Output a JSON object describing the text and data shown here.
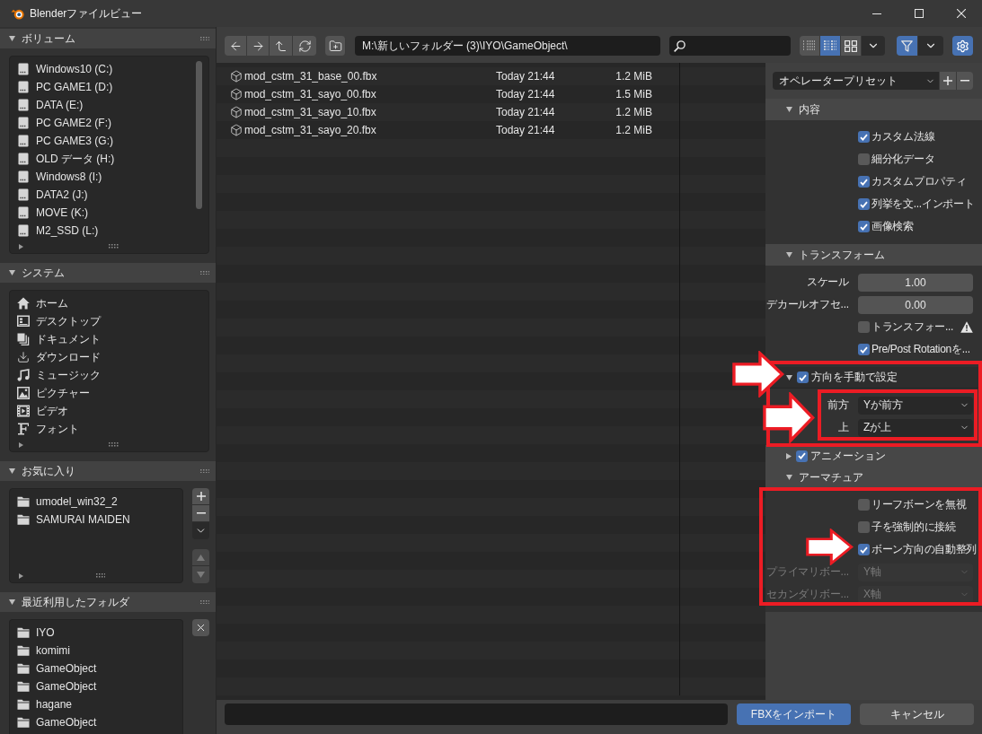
{
  "window": {
    "title": "Blenderファイルビュー"
  },
  "sidebar": {
    "panels": [
      {
        "title": "ボリューム",
        "expanded": true,
        "scrollbar": true,
        "items": [
          {
            "label": "Windows10 (C:)",
            "kind": "drive"
          },
          {
            "label": "PC GAME1 (D:)",
            "kind": "drive"
          },
          {
            "label": "DATA (E:)",
            "kind": "drive"
          },
          {
            "label": "PC GAME2 (F:)",
            "kind": "drive"
          },
          {
            "label": "PC GAME3 (G:)",
            "kind": "drive"
          },
          {
            "label": "OLD データ (H:)",
            "kind": "drive"
          },
          {
            "label": "Windows8 (I:)",
            "kind": "drive"
          },
          {
            "label": "DATA2 (J:)",
            "kind": "drive"
          },
          {
            "label": "MOVE (K:)",
            "kind": "drive"
          },
          {
            "label": "M2_SSD (L:)",
            "kind": "drive"
          }
        ]
      },
      {
        "title": "システム",
        "expanded": true,
        "scrollbar": false,
        "items": [
          {
            "label": "ホーム",
            "kind": "home"
          },
          {
            "label": "デスクトップ",
            "kind": "desktop"
          },
          {
            "label": "ドキュメント",
            "kind": "documents"
          },
          {
            "label": "ダウンロード",
            "kind": "downloads"
          },
          {
            "label": "ミュージック",
            "kind": "music"
          },
          {
            "label": "ピクチャー",
            "kind": "pictures"
          },
          {
            "label": "ビデオ",
            "kind": "videos"
          },
          {
            "label": "フォント",
            "kind": "fonts"
          }
        ]
      },
      {
        "title": "お気に入り",
        "expanded": true,
        "scrollbar": false,
        "items": [
          {
            "label": "umodel_win32_2",
            "kind": "folder"
          },
          {
            "label": "SAMURAI MAIDEN",
            "kind": "folder"
          }
        ],
        "buttons": [
          {
            "kind": "add",
            "disabled": false
          },
          {
            "kind": "remove",
            "disabled": false
          },
          {
            "kind": "menu",
            "disabled": false
          },
          {
            "kind": "up",
            "disabled": true
          },
          {
            "kind": "down",
            "disabled": true
          }
        ]
      },
      {
        "title": "最近利用したフォルダ",
        "expanded": true,
        "scrollbar": false,
        "items": [
          {
            "label": "IYO",
            "kind": "folder"
          },
          {
            "label": "komimi",
            "kind": "folder"
          },
          {
            "label": "GameObject",
            "kind": "folder"
          },
          {
            "label": "GameObject",
            "kind": "folder"
          },
          {
            "label": "hagane",
            "kind": "folder"
          },
          {
            "label": "GameObject",
            "kind": "folder"
          }
        ],
        "buttons": [
          {
            "kind": "clear",
            "disabled": false
          }
        ]
      }
    ]
  },
  "toolbar": {
    "path": "M:\\新しいフォルダー (3)\\IYO\\GameObject\\",
    "view_modes": [
      {
        "kind": "vertical_list",
        "selected": false
      },
      {
        "kind": "horizontal_list",
        "selected": true
      },
      {
        "kind": "thumbnails",
        "selected": false
      }
    ],
    "filter": {
      "on": true
    },
    "settings": {
      "on": true
    }
  },
  "files": [
    {
      "name": "mod_cstm_31_base_00.fbx",
      "date": "Today 21:44",
      "size": "1.2 MiB"
    },
    {
      "name": "mod_cstm_31_sayo_00.fbx",
      "date": "Today 21:44",
      "size": "1.5 MiB"
    },
    {
      "name": "mod_cstm_31_sayo_10.fbx",
      "date": "Today 21:44",
      "size": "1.2 MiB"
    },
    {
      "name": "mod_cstm_31_sayo_20.fbx",
      "date": "Today 21:44",
      "size": "1.2 MiB"
    }
  ],
  "operator": {
    "preset": "オペレータープリセット",
    "panels": [
      {
        "title": "内容",
        "kind": "plain",
        "expanded": true,
        "rows": [
          {
            "kind": "checkbox",
            "label": "カスタム法線",
            "checked": true
          },
          {
            "kind": "checkbox",
            "label": "細分化データ",
            "checked": false
          },
          {
            "kind": "checkbox",
            "label": "カスタムプロパティ",
            "checked": true
          },
          {
            "kind": "checkbox",
            "label": "列挙を文...インポート",
            "checked": true
          },
          {
            "kind": "checkbox",
            "label": "画像検索",
            "checked": true
          }
        ]
      },
      {
        "title": "トランスフォーム",
        "kind": "plain",
        "expanded": true,
        "rows": [
          {
            "kind": "number",
            "label": "スケール",
            "value": "1.00"
          },
          {
            "kind": "number",
            "label": "デカールオフセ...",
            "value": "0.00"
          },
          {
            "kind": "checkbox",
            "label": "トランスフォー...",
            "checked": false,
            "warning": true
          },
          {
            "kind": "checkbox",
            "label": "Pre/Post Rotationを...",
            "checked": true
          }
        ],
        "subpanels": [
          {
            "title": "方向を手動で設定",
            "kind": "toggle",
            "checked": true,
            "expanded": true,
            "rows": [
              {
                "kind": "dropdown",
                "label": "前方",
                "value": "Yが前方",
                "disabled": false
              },
              {
                "kind": "dropdown",
                "label": "上",
                "value": "Zが上",
                "disabled": false
              }
            ]
          }
        ]
      },
      {
        "title": "アニメーション",
        "kind": "toggle",
        "checked": true,
        "expanded": false
      },
      {
        "title": "アーマチュア",
        "kind": "plain",
        "expanded": true,
        "rows": [
          {
            "kind": "checkbox",
            "label": "リーフボーンを無視",
            "checked": false
          },
          {
            "kind": "checkbox",
            "label": "子を強制的に接続",
            "checked": false
          },
          {
            "kind": "checkbox",
            "label": "ボーン方向の自動整列",
            "checked": true
          },
          {
            "kind": "dropdown",
            "label": "プライマリボー...",
            "value": "Y軸",
            "disabled": true
          },
          {
            "kind": "dropdown",
            "label": "セカンダリボー...",
            "value": "X軸",
            "disabled": true
          }
        ]
      }
    ]
  },
  "footer": {
    "buttons": [
      {
        "label": "FBXをインポート",
        "kind": "primary"
      },
      {
        "label": "キャンセル",
        "kind": "secondary"
      }
    ]
  }
}
